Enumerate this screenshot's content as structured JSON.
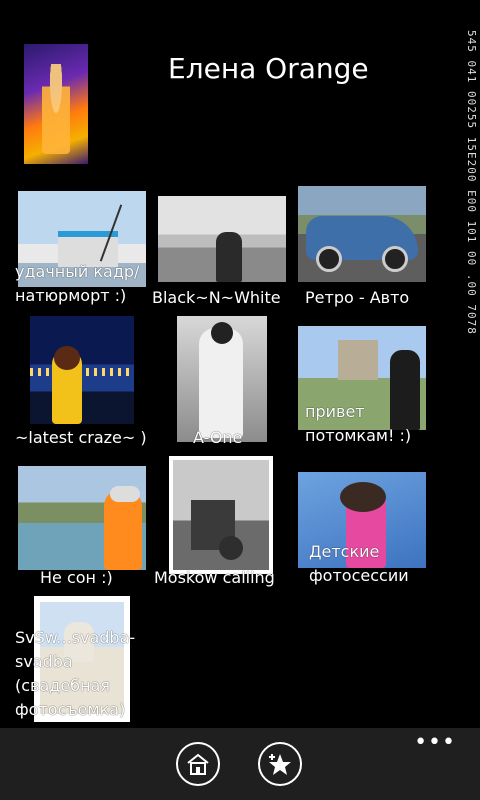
{
  "profile": {
    "name": "Елена Orange"
  },
  "status_strip": "545 041 00255 15E200 E00 101 00 .00 7078",
  "albums": [
    {
      "label": "удачный кадр/ натюрморт :)",
      "icon": "photo-thumbnail"
    },
    {
      "label": "Black~N~White",
      "icon": "photo-thumbnail"
    },
    {
      "label": "Ретро - Авто",
      "icon": "photo-thumbnail"
    },
    {
      "label": "~latest craze~ )",
      "icon": "photo-thumbnail"
    },
    {
      "label": "A-One",
      "icon": "photo-thumbnail"
    },
    {
      "label": "привет потомкам! :)",
      "icon": "photo-thumbnail"
    },
    {
      "label": "Не сон  :)",
      "icon": "photo-thumbnail"
    },
    {
      "label": "Moskow calling",
      "icon": "photo-thumbnail"
    },
    {
      "label": "Детские фотосессии",
      "icon": "photo-thumbnail"
    },
    {
      "label": "SvSw...svadba-svadba (свадебная фотосъемка)",
      "icon": "photo-thumbnail"
    }
  ],
  "appbar": {
    "home_icon": "home-icon",
    "favorite_icon": "star-plus-icon",
    "more": "•••"
  }
}
